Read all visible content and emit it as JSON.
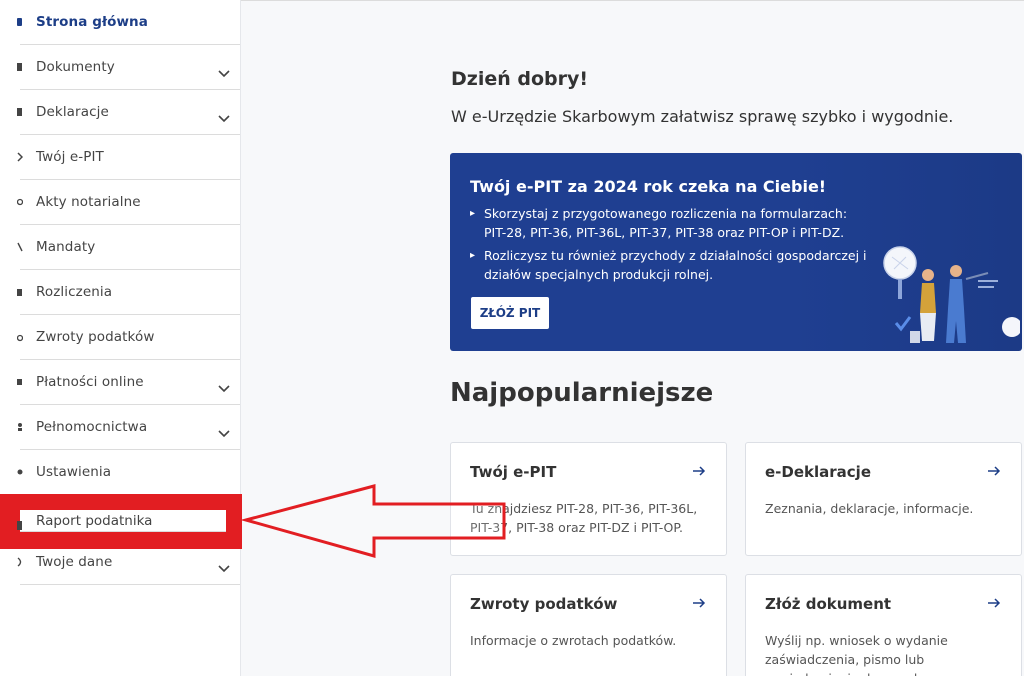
{
  "sidebar": {
    "items": [
      {
        "label": "Strona główna",
        "active": true,
        "chevron": false
      },
      {
        "label": "Dokumenty",
        "chevron": true
      },
      {
        "label": "Deklaracje",
        "chevron": true
      },
      {
        "label": "Twój e-PIT",
        "chevron": false
      },
      {
        "label": "Akty notarialne",
        "chevron": false
      },
      {
        "label": "Mandaty",
        "chevron": false
      },
      {
        "label": "Rozliczenia",
        "chevron": false
      },
      {
        "label": "Zwroty podatków",
        "chevron": false
      },
      {
        "label": "Płatności online",
        "chevron": true
      },
      {
        "label": "Pełnomocnictwa",
        "chevron": true
      },
      {
        "label": "Ustawienia",
        "chevron": false
      },
      {
        "label": "Raport podatnika",
        "chevron": false,
        "highlighted": true
      },
      {
        "label": "Twoje dane",
        "chevron": true
      }
    ]
  },
  "main": {
    "greeting": "Dzień dobry!",
    "subtitle": "W e-Urzędzie Skarbowym załatwisz sprawę szybko i wygodnie.",
    "banner": {
      "title": "Twój e-PIT za 2024 rok czeka na Ciebie!",
      "bullets": [
        "Skorzystaj z przygotowanego rozliczenia na formularzach: PIT-28, PIT-36, PIT-36L, PIT-37, PIT-38 oraz PIT-OP i PIT-DZ.",
        "Rozliczysz tu również przychody z działalności gospodarczej i działów specjalnych produkcji rolnej."
      ],
      "button_label": "ZŁÓŻ PIT"
    },
    "section_title": "Najpopularniejsze",
    "cards": [
      {
        "title": "Twój e-PIT",
        "desc": "Tu znajdziesz PIT-28, PIT-36, PIT-36L, PIT-37, PIT-38 oraz PIT-DZ i PIT-OP."
      },
      {
        "title": "e-Deklaracje",
        "desc": "Zeznania, deklaracje, informacje."
      },
      {
        "title": "Zwroty podatków",
        "desc": "Informacje o zwrotach podatków."
      },
      {
        "title": "Złóż dokument",
        "desc": "Wyślij np. wniosek o wydanie zaświadczenia, pismo lub zawiadomienie do urzędu"
      }
    ]
  },
  "colors": {
    "brand_blue": "#1f3f91",
    "active_text": "#1d3e87",
    "annotation_red": "#e21e22"
  }
}
